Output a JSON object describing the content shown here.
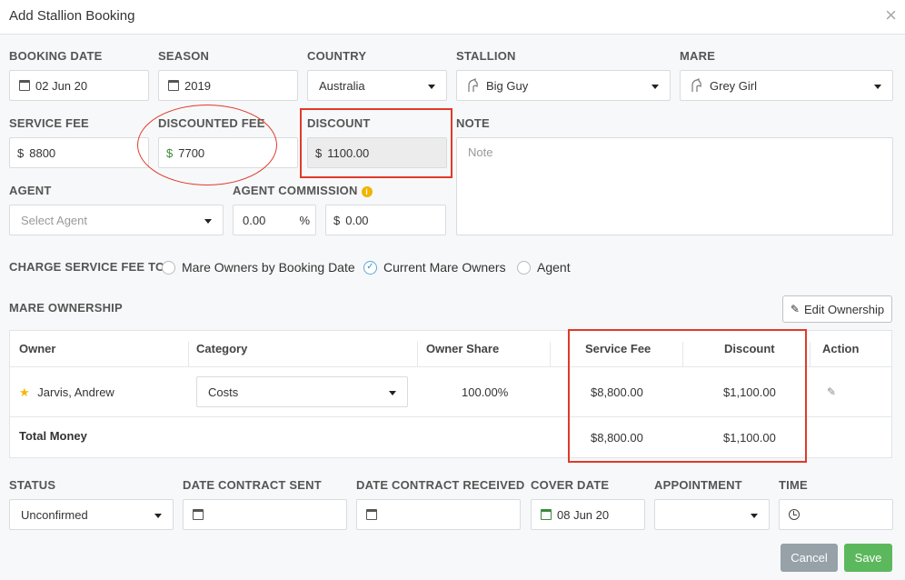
{
  "modal": {
    "title": "Add Stallion Booking",
    "close_glyph": "×"
  },
  "fields": {
    "booking_date": {
      "label": "BOOKING DATE",
      "value": "02 Jun 20"
    },
    "season": {
      "label": "SEASON",
      "value": "2019"
    },
    "country": {
      "label": "COUNTRY",
      "value": "Australia"
    },
    "stallion": {
      "label": "STALLION",
      "value": "Big Guy"
    },
    "mare": {
      "label": "MARE",
      "value": "Grey Girl"
    },
    "service_fee": {
      "label": "SERVICE FEE",
      "currency": "$",
      "value": "8800"
    },
    "discounted_fee": {
      "label": "DISCOUNTED FEE",
      "currency": "$",
      "value": "7700"
    },
    "discount": {
      "label": "DISCOUNT",
      "currency": "$",
      "value": "1100.00"
    },
    "note": {
      "label": "NOTE",
      "placeholder": "Note"
    },
    "agent": {
      "label": "AGENT",
      "placeholder": "Select Agent"
    },
    "agent_commission": {
      "label": "AGENT COMMISSION",
      "percent_value": "0.00",
      "percent_symbol": "%",
      "currency": "$",
      "amount_value": "0.00",
      "info_glyph": "i"
    }
  },
  "charge_service_fee": {
    "label": "CHARGE SERVICE FEE TO",
    "options": [
      {
        "label": "Mare Owners by Booking Date",
        "checked": false
      },
      {
        "label": "Current Mare Owners",
        "checked": true
      },
      {
        "label": "Agent",
        "checked": false
      }
    ]
  },
  "ownership": {
    "label": "MARE OWNERSHIP",
    "edit_button": "Edit Ownership",
    "columns": [
      "Owner",
      "Category",
      "Owner Share",
      "Service Fee",
      "Discount",
      "Action"
    ],
    "rows": [
      {
        "owner": "Jarvis, Andrew",
        "category": "Costs",
        "share": "100.00%",
        "service_fee": "$8,800.00",
        "discount": "$1,100.00"
      }
    ],
    "total": {
      "label": "Total Money",
      "service_fee": "$8,800.00",
      "discount": "$1,100.00"
    }
  },
  "bottom": {
    "status": {
      "label": "STATUS",
      "value": "Unconfirmed"
    },
    "date_contract_sent": {
      "label": "DATE CONTRACT SENT",
      "value": ""
    },
    "date_contract_received": {
      "label": "DATE CONTRACT RECEIVED",
      "value": ""
    },
    "cover_date": {
      "label": "COVER DATE",
      "value": "08 Jun 20"
    },
    "appointment": {
      "label": "APPOINTMENT",
      "value": ""
    },
    "time": {
      "label": "TIME",
      "value": ""
    }
  },
  "actions": {
    "cancel": "Cancel",
    "save": "Save"
  },
  "colors": {
    "save": "#5cb85c",
    "cancel": "#96a1a8",
    "highlight": "#e03a2a",
    "check": "#3b8fc4"
  },
  "icons": [
    "calendar-icon",
    "horse-icon",
    "pencil-icon",
    "star-icon",
    "clock-icon",
    "info-icon",
    "close-icon",
    "chevron-down-icon"
  ]
}
